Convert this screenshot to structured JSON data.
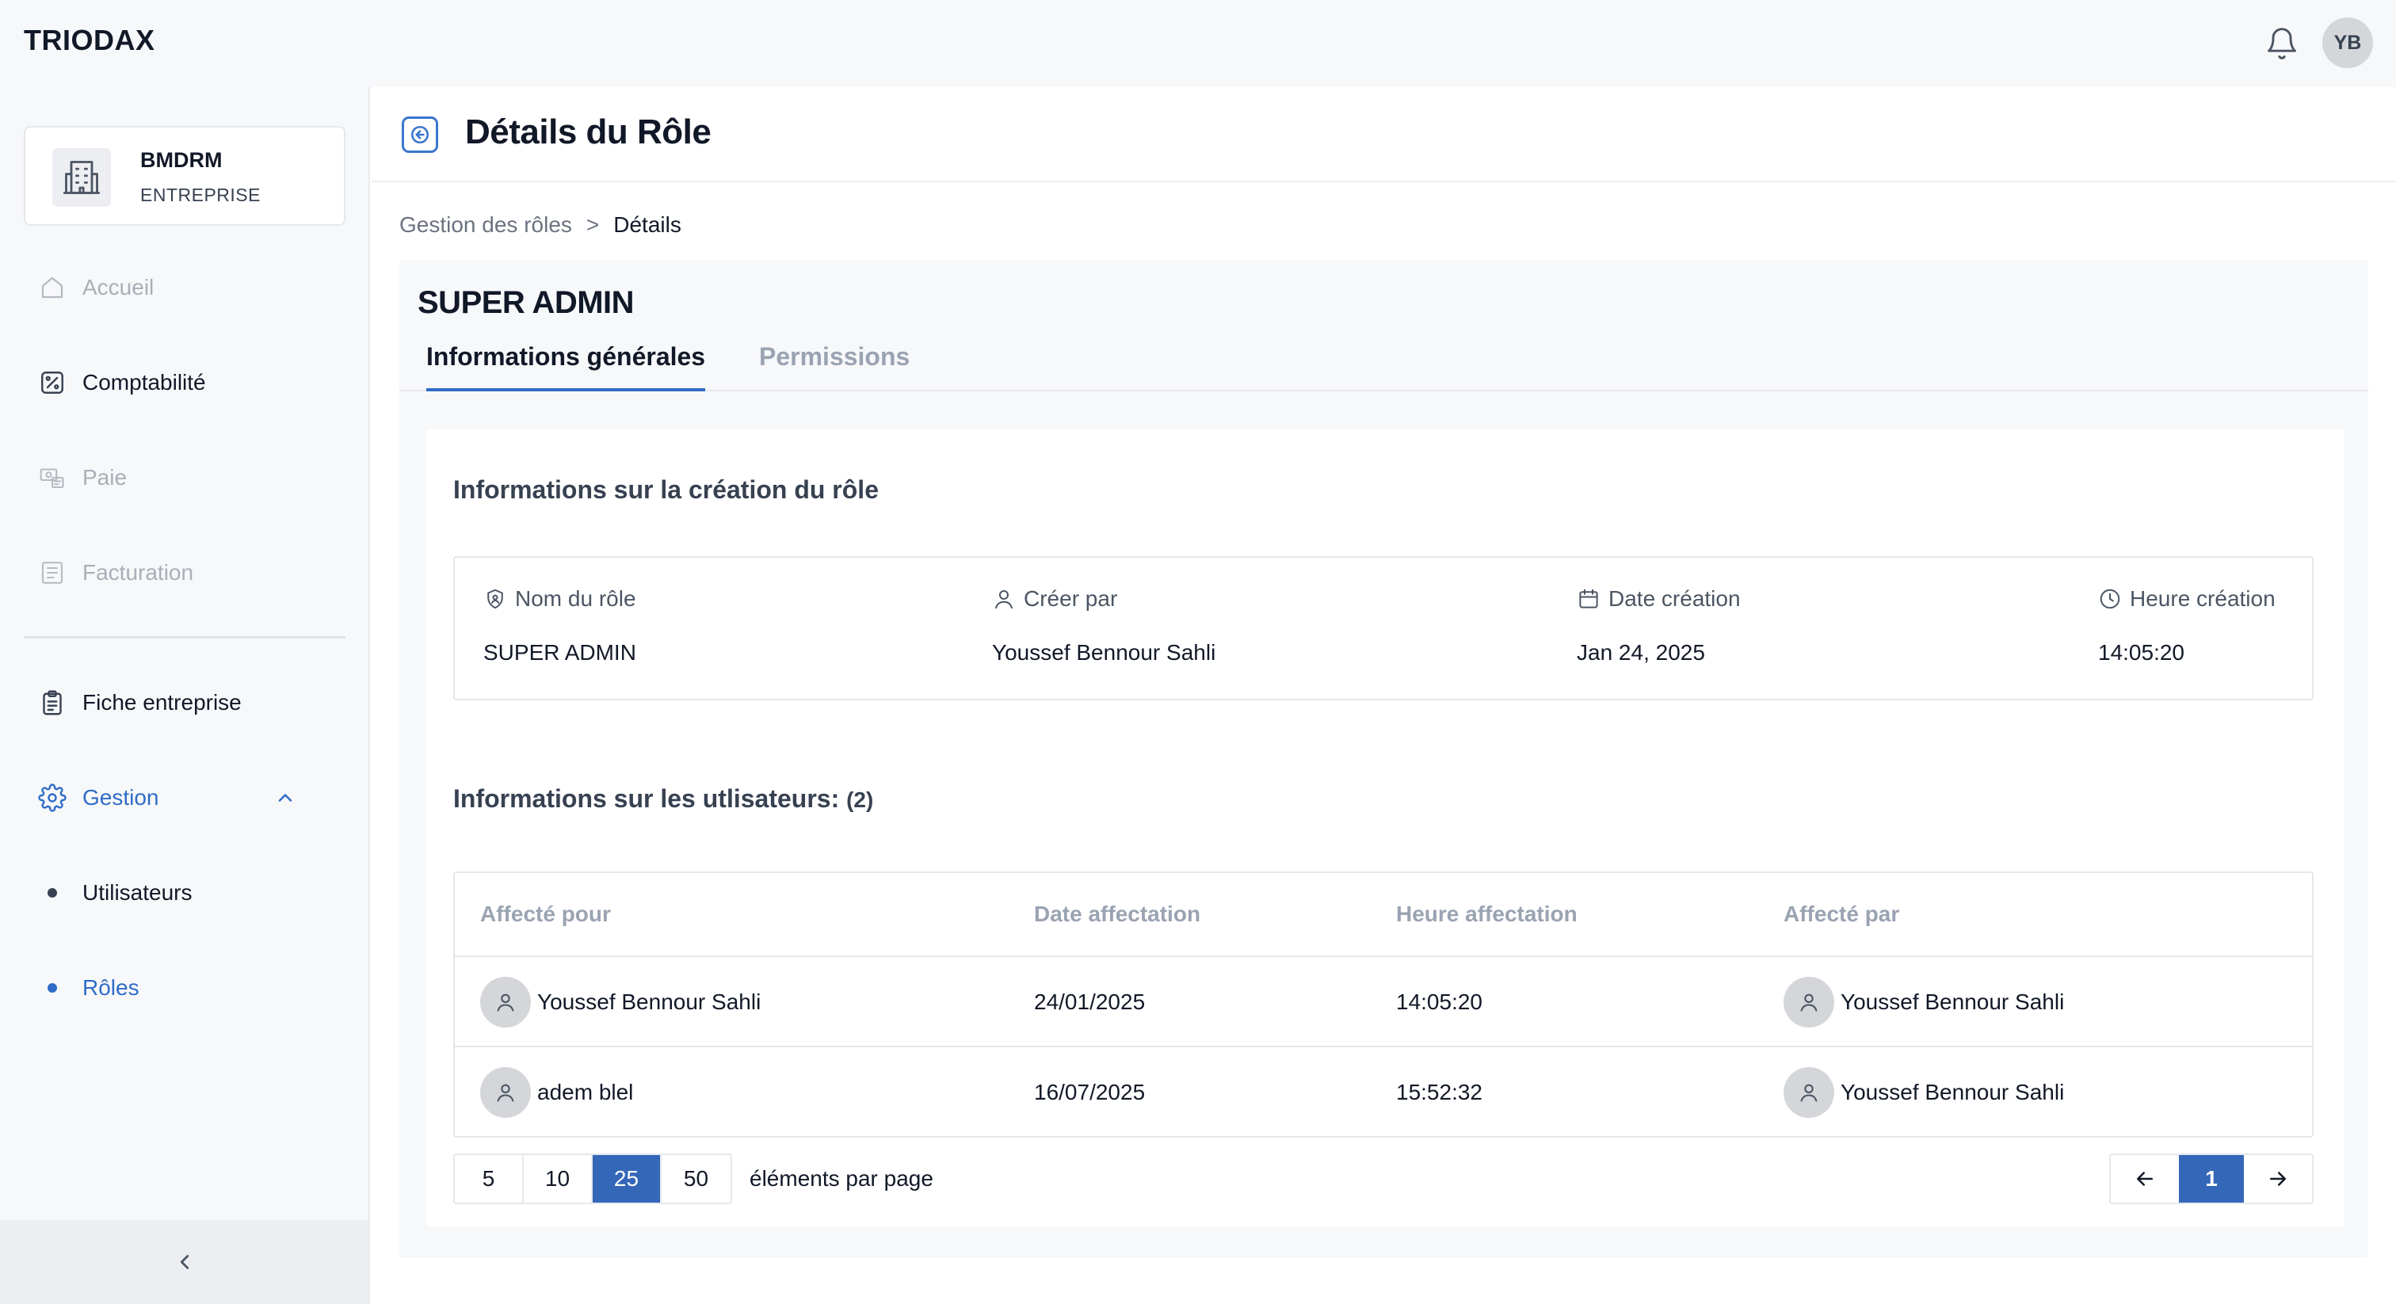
{
  "app": {
    "logo": "TRIODAX",
    "user_initials": "YB"
  },
  "company": {
    "name": "BMDRM",
    "type": "ENTREPRISE"
  },
  "sidebar": {
    "items": [
      {
        "label": "Accueil",
        "icon": "home-icon",
        "state": "disabled"
      },
      {
        "label": "Comptabilité",
        "icon": "percent-icon",
        "state": "normal"
      },
      {
        "label": "Paie",
        "icon": "payroll-icon",
        "state": "disabled"
      },
      {
        "label": "Facturation",
        "icon": "invoice-icon",
        "state": "disabled"
      },
      {
        "label": "Fiche entreprise",
        "icon": "clipboard-icon",
        "state": "normal"
      },
      {
        "label": "Gestion",
        "icon": "gear-icon",
        "state": "active",
        "expanded": true
      }
    ],
    "sub_items": [
      {
        "label": "Utilisateurs",
        "state": "normal"
      },
      {
        "label": "Rôles",
        "state": "active"
      }
    ]
  },
  "page": {
    "title": "Détails du Rôle"
  },
  "breadcrumb": {
    "parent": "Gestion des rôles",
    "separator": ">",
    "current": "Détails"
  },
  "role": {
    "name": "SUPER ADMIN"
  },
  "tabs": [
    {
      "label": "Informations générales",
      "active": true
    },
    {
      "label": "Permissions",
      "active": false
    }
  ],
  "creation_info": {
    "title": "Informations sur la création du rôle",
    "fields": [
      {
        "label": "Nom du rôle",
        "value": "SUPER ADMIN",
        "icon": "badge-icon"
      },
      {
        "label": "Créer par",
        "value": "Youssef Bennour Sahli",
        "icon": "user-icon"
      },
      {
        "label": "Date création",
        "value": "Jan 24, 2025",
        "icon": "calendar-icon"
      },
      {
        "label": "Heure création",
        "value": "14:05:20",
        "icon": "clock-icon"
      }
    ]
  },
  "users_info": {
    "title": "Informations sur les utlisateurs:",
    "count": "(2)",
    "columns": [
      "Affecté pour",
      "Date affectation",
      "Heure affectation",
      "Affecté par"
    ],
    "rows": [
      {
        "assigned_to": "Youssef Bennour Sahli",
        "date": "24/01/2025",
        "time": "14:05:20",
        "assigned_by": "Youssef Bennour Sahli"
      },
      {
        "assigned_to": "adem blel",
        "date": "16/07/2025",
        "time": "15:52:32",
        "assigned_by": "Youssef Bennour Sahli"
      }
    ]
  },
  "pagination": {
    "page_sizes": [
      "5",
      "10",
      "25",
      "50"
    ],
    "selected_size": "25",
    "per_page_label": "éléments par page",
    "current_page": "1"
  },
  "colors": {
    "accent": "#2f6cc7",
    "selected_bg": "#3567b8",
    "panel_bg": "#f7f8fa",
    "muted_text": "#9aa3b2"
  }
}
